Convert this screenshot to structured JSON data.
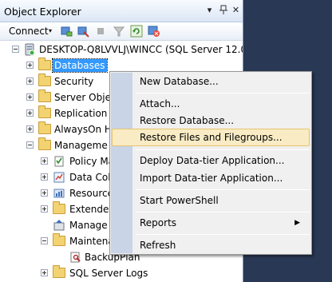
{
  "panel": {
    "title": "Object Explorer",
    "pin_glyph": "▾",
    "autohide_glyph": "📌",
    "close_glyph": "✕"
  },
  "toolbar": {
    "connect_label": "Connect",
    "connect_arrow": "▾",
    "icons": [
      "connect-object-explorer-icon",
      "disconnect-icon",
      "stop-icon",
      "filter-icon",
      "refresh-icon",
      "disconnect-all-icon"
    ]
  },
  "tree": {
    "server": "DESKTOP-Q8LVVLJ\\WINCC (SQL Server 12.0",
    "databases": "Databases",
    "security": "Security",
    "server_objects": "Server Obje",
    "replication": "Replication",
    "alwayson": "AlwaysOn H",
    "management": "Manageme",
    "policy": "Policy Ma",
    "data_collection": "Data Col",
    "resource": "Resource",
    "extended": "Extende",
    "managed": "Manage",
    "maintenance": "Maintena",
    "backup_plan": "BackupPlan",
    "sql_server_logs": "SQL Server Logs"
  },
  "context_menu": {
    "items": [
      "New Database...",
      "Attach...",
      "Restore Database...",
      "Restore Files and Filegroups...",
      "Deploy Data-tier Application...",
      "Import Data-tier Application...",
      "Start PowerShell",
      "Reports",
      "Refresh"
    ],
    "highlighted": "Restore Files and Filegroups...",
    "submenu_arrow": "▶"
  },
  "colors": {
    "selection": "#3399ff",
    "menu_highlight": "#f9ecc5",
    "background": "#293955"
  }
}
